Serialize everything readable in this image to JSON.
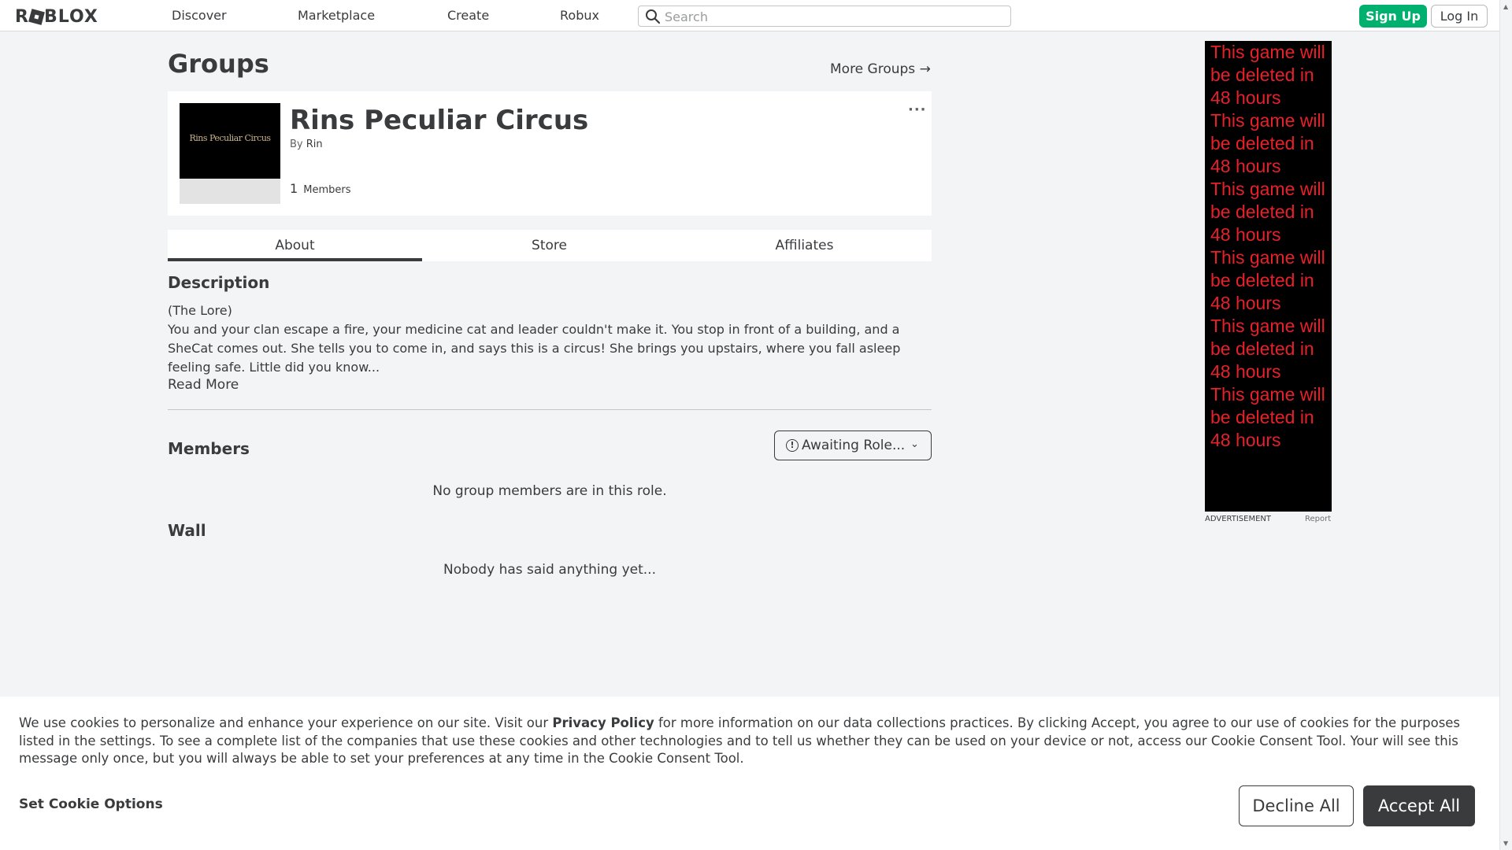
{
  "nav": {
    "logo": "ROBLOX",
    "links": [
      "Discover",
      "Marketplace",
      "Create",
      "Robux"
    ],
    "search_placeholder": "Search",
    "signup": "Sign Up",
    "login": "Log In"
  },
  "page": {
    "title": "Groups",
    "more_groups": "More Groups →"
  },
  "group": {
    "emblem_text": "Rins Peculiar Circus",
    "name": "Rins Peculiar Circus",
    "by_label": "By",
    "owner": "Rin",
    "members_count": "1",
    "members_label": "Members",
    "menu_icon": "more-dots-icon"
  },
  "tabs": [
    "About",
    "Store",
    "Affiliates"
  ],
  "description": {
    "heading": "Description",
    "line1": "(The Lore)",
    "body": "You and your clan escape a fire, your medicine cat and leader couldn't make it. You stop in front of a building, and a SheCat comes out. She tells you to come in, and says this is a circus! She brings you upstairs, where you fall asleep feeling safe. Little did you know...",
    "read_more": "Read More"
  },
  "members": {
    "heading": "Members",
    "role_dropdown": "Awaiting Role...",
    "empty": "No group members are in this role."
  },
  "wall": {
    "heading": "Wall",
    "empty": "Nobody has said anything yet..."
  },
  "ad": {
    "lines": [
      "This game will",
      "be deleted in",
      "48 hours"
    ],
    "repeat_count": 6,
    "label": "ADVERTISEMENT",
    "report": "Report",
    "text_color": "#e8202a"
  },
  "cookie": {
    "text_before": "We use cookies to personalize and enhance your experience on our site. Visit our ",
    "privacy_link": "Privacy Policy",
    "text_after": " for more information on our data collections practices. By clicking Accept, you agree to our use of cookies for the purposes listed in the settings. To see a complete list of the companies that use these cookies and other technologies and to tell us whether they can be used on your device or not, access our Cookie Consent Tool. Your will see this message only once, but you will always be able to set your preferences at any time in the Cookie Consent Tool.",
    "set_options": "Set Cookie Options",
    "decline": "Decline All",
    "accept": "Accept All"
  },
  "colors": {
    "accent_green": "#00b06f",
    "text_dark": "#393b3d",
    "background": "#f2f4f5"
  }
}
